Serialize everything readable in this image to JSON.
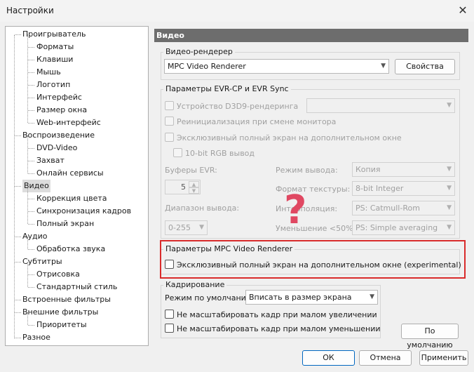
{
  "window": {
    "title": "Настройки",
    "close": "✕"
  },
  "tree": [
    {
      "label": "Проигрыватель",
      "level": 0
    },
    {
      "label": "Форматы",
      "level": 1
    },
    {
      "label": "Клавиши",
      "level": 1
    },
    {
      "label": "Мышь",
      "level": 1
    },
    {
      "label": "Логотип",
      "level": 1
    },
    {
      "label": "Интерфейс",
      "level": 1
    },
    {
      "label": "Размер окна",
      "level": 1
    },
    {
      "label": "Web-интерфейс",
      "level": 1
    },
    {
      "label": "Воспроизведение",
      "level": 0
    },
    {
      "label": "DVD-Video",
      "level": 1
    },
    {
      "label": "Захват",
      "level": 1
    },
    {
      "label": "Онлайн сервисы",
      "level": 1
    },
    {
      "label": "Видео",
      "level": 0,
      "selected": true
    },
    {
      "label": "Коррекция цвета",
      "level": 1
    },
    {
      "label": "Синхронизация кадров",
      "level": 1
    },
    {
      "label": "Полный экран",
      "level": 1
    },
    {
      "label": "Аудио",
      "level": 0
    },
    {
      "label": "Обработка звука",
      "level": 1
    },
    {
      "label": "Субтитры",
      "level": 0
    },
    {
      "label": "Отрисовка",
      "level": 1
    },
    {
      "label": "Стандартный стиль",
      "level": 1
    },
    {
      "label": "Встроенные фильтры",
      "level": 0
    },
    {
      "label": "Внешние фильтры",
      "level": 0
    },
    {
      "label": "Приоритеты",
      "level": 1
    },
    {
      "label": "Разное",
      "level": 0
    }
  ],
  "panel": {
    "header": "Видео",
    "renderer": {
      "group": "Видео-рендерер",
      "value": "MPC Video Renderer",
      "props_button": "Свойства"
    },
    "evr": {
      "group": "Параметры EVR-CP и EVR Sync",
      "d3d9": "Устройство D3D9-рендеринга",
      "reinit": "Реинициализация при смене монитора",
      "exclusive": "Эксклюзивный полный экран на дополнительном окне",
      "rgb10": "10-bit RGB вывод",
      "buffers_label": "Буферы EVR:",
      "buffers_value": "5",
      "range_label": "Диапазон вывода:",
      "range_value": "0-255",
      "output_mode_label": "Режим вывода:",
      "output_mode_value": "Копия",
      "texture_label": "Формат текстуры:",
      "texture_value": "8-bit Integer",
      "interp_label": "Интерполяция:",
      "interp_value": "PS: Catmull-Rom",
      "down_label": "Уменьшение <50%:",
      "down_value": "PS: Simple averaging"
    },
    "mpcvr": {
      "group": "Параметры MPC Video Renderer",
      "exclusive": "Эксклюзивный полный экран на дополнительном окне (experimental)"
    },
    "crop": {
      "group": "Кадрирование",
      "mode_label": "Режим по умолчанию:",
      "mode_value": "Вписать в размер экрана",
      "no_upscale": "Не масштабировать кадр при малом увеличении",
      "no_downscale": "Не масштабировать кадр при малом уменьшении"
    },
    "defaults_button": "По умолчанию"
  },
  "footer": {
    "ok": "ОК",
    "cancel": "Отмена",
    "apply": "Применить"
  },
  "overlay": {
    "question_mark": "?",
    "highlight_color": "#d92b2b",
    "question_color": "#e04862"
  }
}
